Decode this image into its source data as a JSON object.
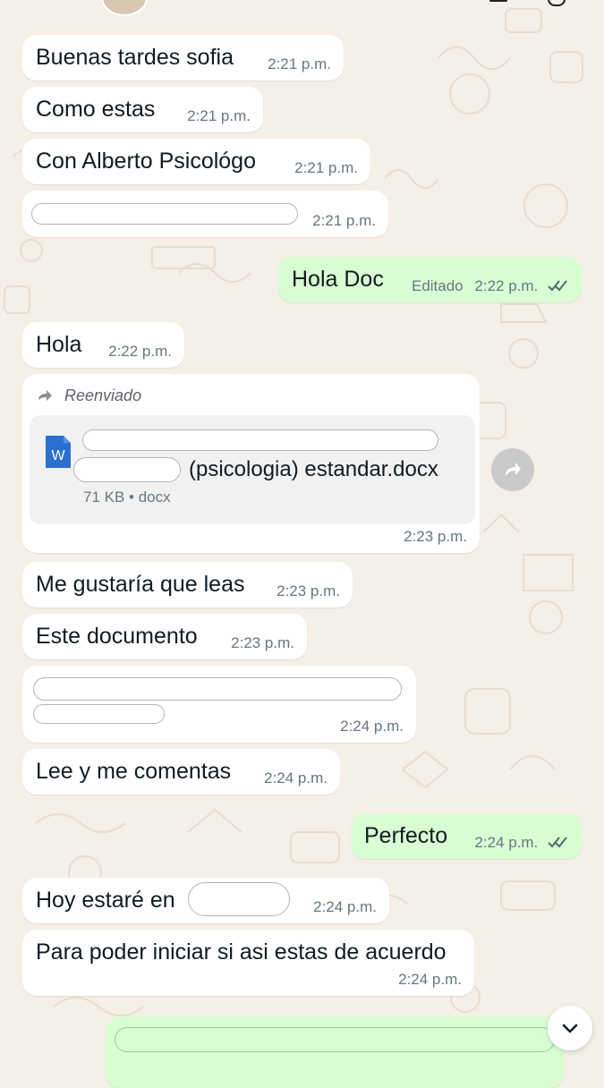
{
  "messages": [
    {
      "text": "Buenas tardes sofia",
      "time": "2:21 p.m."
    },
    {
      "text": "Como estas",
      "time": "2:21 p.m."
    },
    {
      "text": "Con Alberto Psicológo",
      "time": "2:21 p.m."
    },
    {
      "text": "",
      "time": "2:21 p.m."
    },
    {
      "text": "Hola Doc",
      "edited": "Editado",
      "time": "2:22 p.m."
    },
    {
      "text": "Hola",
      "time": "2:22 p.m."
    },
    {
      "forwarded_label": "Reenviado",
      "file_name": "(psicologia) estandar.docx",
      "file_meta": "71 KB • docx",
      "file_icon_letter": "W",
      "time": "2:23 p.m."
    },
    {
      "text": "Me gustaría que leas",
      "time": "2:23 p.m."
    },
    {
      "text": "Este documento",
      "time": "2:23 p.m."
    },
    {
      "text": "",
      "time": "2:24 p.m."
    },
    {
      "text": "Lee y me comentas",
      "time": "2:24 p.m."
    },
    {
      "text": "Perfecto",
      "time": "2:24 p.m."
    },
    {
      "text": "Hoy estaré en",
      "time": "2:24 p.m."
    },
    {
      "text": "Para poder iniciar si asi estas de acuerdo",
      "time": "2:24 p.m."
    }
  ],
  "icons": {
    "forward_icon": "forward-arrow-icon",
    "share_icon": "share-icon",
    "scroll_icon": "chevron-down-icon",
    "read_icon": "double-check-icon",
    "file_icon": "word-document-icon"
  },
  "colors": {
    "wallpaper": "#f4efe7",
    "incoming_bubble": "#ffffff",
    "outgoing_bubble": "#d9fdd3",
    "time_text": "#667781",
    "read_receipts": "#54656f",
    "word_blue": "#2b6fd1"
  }
}
